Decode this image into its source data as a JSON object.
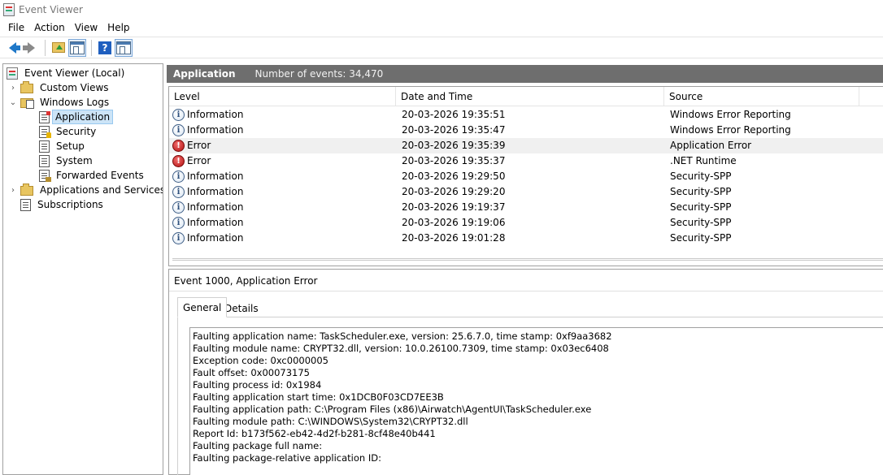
{
  "window": {
    "title": "Event Viewer"
  },
  "menu": [
    "File",
    "Action",
    "View",
    "Help"
  ],
  "toolbar": {
    "icons": [
      "back-arrow-icon",
      "forward-arrow-icon",
      "folder-up-icon",
      "show-hide-console-tree-icon",
      "help-icon",
      "show-hide-action-pane-icon"
    ],
    "help_glyph": "?"
  },
  "tree": {
    "root": "Event Viewer (Local)",
    "custom_views": "Custom Views",
    "windows_logs": "Windows Logs",
    "application": "Application",
    "security": "Security",
    "setup": "Setup",
    "system": "System",
    "forwarded_events": "Forwarded Events",
    "apps_services": "Applications and Services Lo",
    "subscriptions": "Subscriptions",
    "expander_collapsed": "›",
    "expander_expanded": "⌄"
  },
  "log_header": {
    "title": "Application",
    "count": "Number of events: 34,470"
  },
  "grid": {
    "columns": {
      "level": "Level",
      "date": "Date and Time",
      "source": "Source"
    },
    "rows": [
      {
        "level": "Information",
        "type": "info",
        "date": "20-03-2026 19:35:51",
        "source": "Windows Error Reporting"
      },
      {
        "level": "Information",
        "type": "info",
        "date": "20-03-2026 19:35:47",
        "source": "Windows Error Reporting"
      },
      {
        "level": "Error",
        "type": "error",
        "date": "20-03-2026 19:35:39",
        "source": "Application Error"
      },
      {
        "level": "Error",
        "type": "error",
        "date": "20-03-2026 19:35:37",
        "source": ".NET Runtime"
      },
      {
        "level": "Information",
        "type": "info",
        "date": "20-03-2026 19:29:50",
        "source": "Security-SPP"
      },
      {
        "level": "Information",
        "type": "info",
        "date": "20-03-2026 19:29:20",
        "source": "Security-SPP"
      },
      {
        "level": "Information",
        "type": "info",
        "date": "20-03-2026 19:19:37",
        "source": "Security-SPP"
      },
      {
        "level": "Information",
        "type": "info",
        "date": "20-03-2026 19:19:06",
        "source": "Security-SPP"
      },
      {
        "level": "Information",
        "type": "info",
        "date": "20-03-2026 19:01:28",
        "source": "Security-SPP"
      }
    ],
    "highlighted_row": 2
  },
  "details": {
    "title": "Event 1000, Application Error",
    "tabs": {
      "general": "General",
      "details": "Details"
    },
    "description": [
      "Faulting application name: TaskScheduler.exe, version: 25.6.7.0, time stamp: 0xf9aa3682",
      "Faulting module name: CRYPT32.dll, version: 10.0.26100.7309, time stamp: 0x03ec6408",
      "Exception code: 0xc0000005",
      "Fault offset: 0x00073175",
      "Faulting process id: 0x1984",
      "Faulting application start time: 0x1DCB0F03CD7EE3B",
      "Faulting application path: C:\\Program Files (x86)\\Airwatch\\AgentUI\\TaskScheduler.exe",
      "Faulting module path: C:\\WINDOWS\\System32\\CRYPT32.dll",
      "Report Id: b173f562-eb42-4d2f-b281-8cf48e40b441",
      "Faulting package full name:",
      "Faulting package-relative application ID:"
    ]
  },
  "colors": {
    "header_bg": "#6e6e6e",
    "selection": "#cce4f7",
    "error": "#b31010",
    "info": "#3e5e86"
  }
}
